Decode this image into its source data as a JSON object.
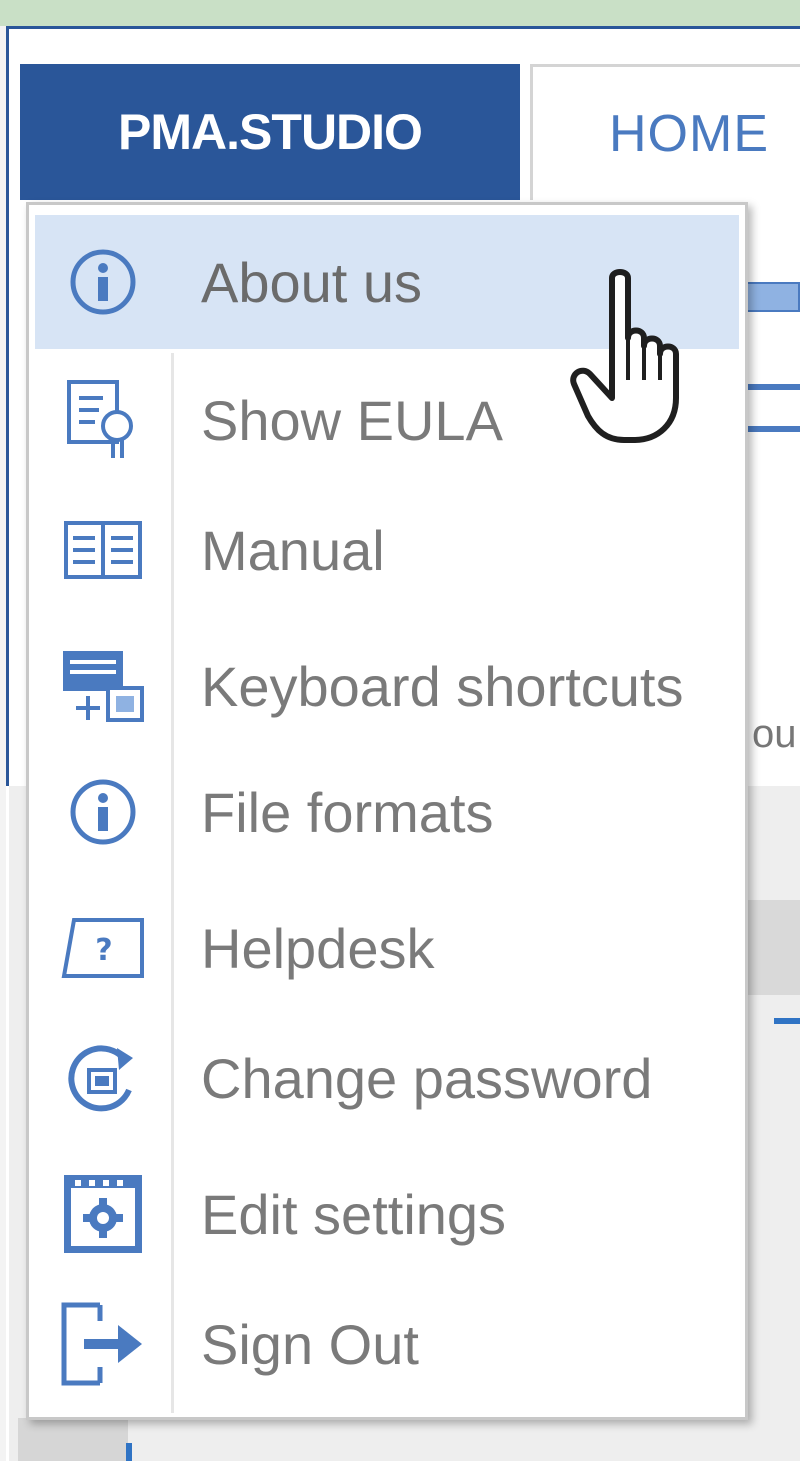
{
  "brand": {
    "label": "PMA.STUDIO"
  },
  "tabs": [
    {
      "label": "HOME"
    }
  ],
  "ribbon": {
    "partial_text": "ou"
  },
  "menu": {
    "items": [
      {
        "label": "About us",
        "icon": "info-icon",
        "hovered": true
      },
      {
        "label": "Show EULA",
        "icon": "certificate-icon"
      },
      {
        "label": "Manual",
        "icon": "book-icon"
      },
      {
        "label": "Keyboard shortcuts",
        "icon": "keyboard-icon"
      },
      {
        "label": "File formats",
        "icon": "info-icon"
      },
      {
        "label": "Helpdesk",
        "icon": "help-icon"
      },
      {
        "label": "Change password",
        "icon": "lock-refresh-icon"
      },
      {
        "label": "Edit settings",
        "icon": "settings-icon"
      },
      {
        "label": "Sign Out",
        "icon": "sign-out-icon"
      }
    ]
  },
  "colors": {
    "accent": "#2a5699",
    "icon": "#4a7ac0",
    "hover": "#d7e4f5"
  }
}
